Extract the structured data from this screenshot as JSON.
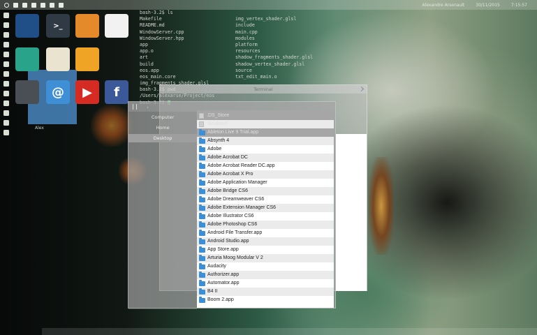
{
  "top_bar": {
    "user": "Alexandre Arsenault",
    "date": "30/11/2015",
    "time": "7:15:57",
    "icons": [
      "ubuntu-icon",
      "wifi-icon",
      "grid-icon",
      "window-icon",
      "gear-icon",
      "folder-icon",
      "more-icon"
    ]
  },
  "left_dock": {
    "icons": [
      "monitor-icon",
      "arrow-icon",
      "folder-icon",
      "pin-icon",
      "image-icon",
      "doc-icon",
      "cart-icon",
      "mail-icon",
      "heart-icon",
      "facebook-icon",
      "cloud-icon",
      "square-icon",
      "circle-icon"
    ]
  },
  "launcher": {
    "label": "Alex",
    "apps": [
      {
        "name": "monitor-app",
        "glyph": "",
        "color": "#1f4f86"
      },
      {
        "name": "terminal-app",
        "glyph": ">_",
        "color": "#2f3a44"
      },
      {
        "name": "photos-app",
        "glyph": "",
        "color": "#e48a2a"
      },
      {
        "name": "calendar-app",
        "glyph": "",
        "color": "#f2f2f2"
      },
      {
        "name": "books-app",
        "glyph": "",
        "color": "#2aa38b"
      },
      {
        "name": "notes-app",
        "glyph": "",
        "color": "#e9e3cf"
      },
      {
        "name": "mail-app",
        "glyph": "",
        "color": "#f0a426"
      },
      {
        "name": "tools-app",
        "glyph": "",
        "color": "#ffffff00"
      },
      {
        "name": "calculator-app",
        "glyph": "",
        "color": "#4a4f55"
      },
      {
        "name": "contacts-app",
        "glyph": "@",
        "color": "#3f8fd6"
      },
      {
        "name": "youtube-app",
        "glyph": "▶",
        "color": "#d62b22"
      },
      {
        "name": "facebook-app",
        "glyph": "f",
        "color": "#3b5998"
      }
    ]
  },
  "terminal": {
    "window_title": "Terminal",
    "col_a": [
      "bash-3.2$ ls",
      "Makefile",
      "README.md",
      "WindowServer.cpp",
      "WindowServer.hpp",
      "app",
      "app.o",
      "art",
      "build",
      "eos.app",
      "eos_main.core",
      "img_fragments_shader.glsl",
      "bash-3.2$ pwd",
      "/Users/alexarse/Project/eos",
      "bash-3.2$ "
    ],
    "col_b": [
      "",
      "img_vertex_shader.glsl",
      "include",
      "main.cpp",
      "modules",
      "platform",
      "resources",
      "shadow_fragments_shader.glsl",
      "shadow_vertex_shader.glsl",
      "source",
      "txt_edit_main.o"
    ]
  },
  "file_browser": {
    "sidebar": [
      {
        "label": "Computer",
        "active": false
      },
      {
        "label": "Home",
        "active": false
      },
      {
        "label": "Desktop",
        "active": true
      }
    ],
    "items": [
      {
        "label": ".DS_Store",
        "type": "file",
        "faded": true
      },
      {
        "label": ".localized",
        "type": "file",
        "faded": true
      },
      {
        "label": "Ableton Live 9 Trial.app",
        "type": "folder",
        "faded": true
      },
      {
        "label": "Absynth 4",
        "type": "folder",
        "faded": false
      },
      {
        "label": "Adobe",
        "type": "folder",
        "faded": false
      },
      {
        "label": "Adobe Acrobat DC",
        "type": "folder",
        "faded": false
      },
      {
        "label": "Adobe Acrobat Reader DC.app",
        "type": "folder",
        "faded": false
      },
      {
        "label": "Adobe Acrobat X Pro",
        "type": "folder",
        "faded": false
      },
      {
        "label": "Adobe Application Manager",
        "type": "folder",
        "faded": false
      },
      {
        "label": "Adobe Bridge CS6",
        "type": "folder",
        "faded": false
      },
      {
        "label": "Adobe Dreamweaver CS6",
        "type": "folder",
        "faded": false
      },
      {
        "label": "Adobe Extension Manager CS6",
        "type": "folder",
        "faded": false
      },
      {
        "label": "Adobe Illustrator CS6",
        "type": "folder",
        "faded": false
      },
      {
        "label": "Adobe Photoshop CS6",
        "type": "folder",
        "faded": false
      },
      {
        "label": "Android File Transfer.app",
        "type": "folder",
        "faded": false
      },
      {
        "label": "Android Studio.app",
        "type": "folder",
        "faded": false
      },
      {
        "label": "App Store.app",
        "type": "folder",
        "faded": false
      },
      {
        "label": "Arturia Moog Modular V 2",
        "type": "folder",
        "faded": false
      },
      {
        "label": "Audacity",
        "type": "folder",
        "faded": false
      },
      {
        "label": "Authorizer.app",
        "type": "folder",
        "faded": false
      },
      {
        "label": "Automator.app",
        "type": "folder",
        "faded": false
      },
      {
        "label": "B4 II",
        "type": "folder",
        "faded": false
      },
      {
        "label": "Boom 2.app",
        "type": "folder",
        "faded": false
      }
    ]
  }
}
